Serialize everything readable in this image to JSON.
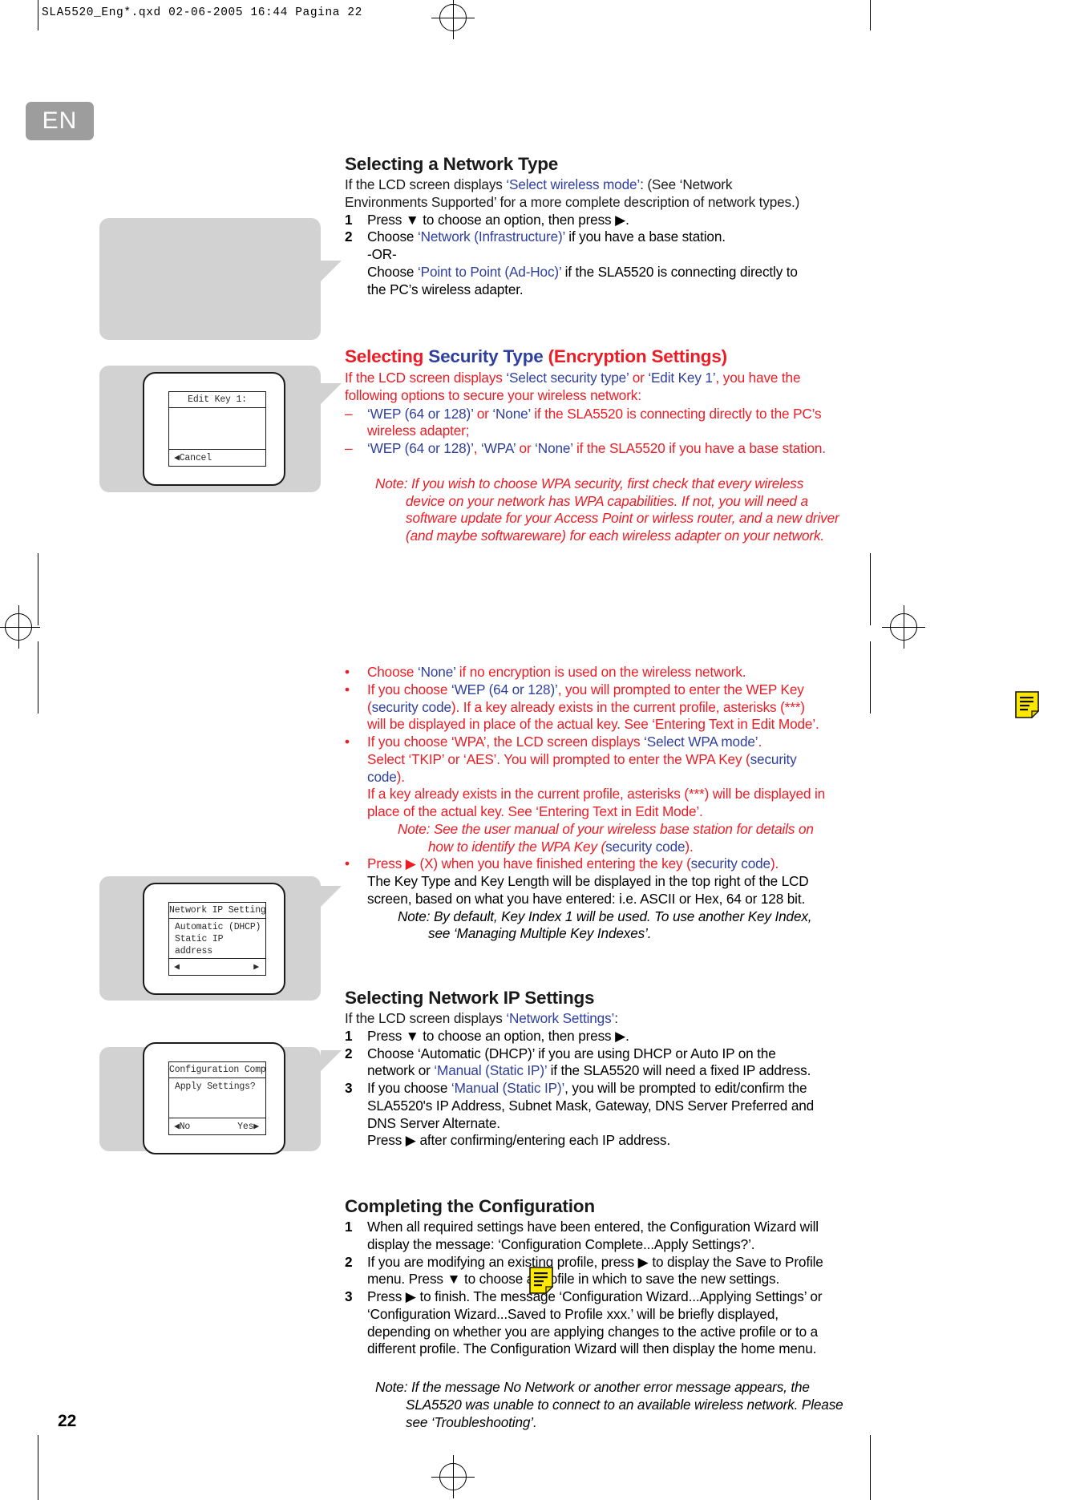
{
  "printer_slug": "SLA5520_Eng*.qxd  02-06-2005  16:44  Pagina 22",
  "language_tab": "EN",
  "page_number": "22",
  "colors": {
    "blue": "#2e3f9e",
    "red": "#ec1c24",
    "grey_panel": "#d2d2d2",
    "lang_tab_bg": "#9d9d9d"
  },
  "sections": {
    "network_type": {
      "heading": "Selecting a Network Type",
      "intro_a": "If the LCD screen displays ",
      "intro_blue": "‘Select wireless mode’",
      "intro_b": ": (See ‘Network Environments Supported’ for a more complete description of network types.)",
      "steps": [
        {
          "num": "1",
          "a": "Press ▼ to choose an option, then press ▶."
        },
        {
          "num": "2",
          "a": "Choose ",
          "blue1": "‘Network (Infrastructure)’",
          "b": " if you have a base station.",
          "or": "-OR-",
          "c": "Choose ",
          "blue2": "‘Point to Point (Ad-Hoc)’",
          "d": " if the SLA5520 is connecting directly to the PC’s wireless adapter."
        }
      ]
    },
    "security_type": {
      "heading_red1": "Selecting ",
      "heading_blue": "Security Type ",
      "heading_red2": "(Encryption Settings)",
      "intro_a": "If the LCD screen displays ",
      "intro_blue1": "‘Select security type’",
      "intro_b": " or ",
      "intro_blue2": "‘Edit Key 1’",
      "intro_c": ", you have the following options to secure your wireless network:",
      "dashes": [
        {
          "blue1": "‘WEP (64 or 128)’",
          "mid": " or ",
          "blue2": "‘None’",
          "tail": " if the SLA5520 is connecting directly to the PC’s wireless adapter;"
        },
        {
          "blue1": "‘WEP (64 or 128)’",
          "mid": ", ",
          "blue2": "‘WPA’",
          "mid2": " or ",
          "blue3": "‘None’",
          "tail": " if the SLA5520 if you have a base station."
        }
      ],
      "note_wpa": "Note: If you wish to choose WPA security, first check that every wireless device on your network has WPA capabilities. If not, you will need a software update for your Access Point or wirless router, and a new driver (and maybe softwareware) for each wireless adapter on your network.",
      "bullets": [
        {
          "a": "Choose ",
          "blue1": "‘None’",
          "b": " if no encryption is used on the wireless network."
        },
        {
          "a": "If you choose ",
          "blue1": "‘WEP (64 or 128)’",
          "b": ", you will prompted to enter the WEP Key (",
          "blue2": "security code",
          "c": "). If a key already exists in the current profile, asterisks (***) will be displayed in place of the actual key. See ‘Entering Text in Edit Mode’."
        },
        {
          "a": "If you choose ‘WPA’, the LCD screen displays ",
          "blue1": "‘Select WPA mode’",
          "b": ".",
          "l2_a": "Select ‘TKIP’ or ‘AES’. You will prompted to enter the WPA Key (",
          "l2_blue": "security code",
          "l2_b": ").",
          "l3": "If a key already exists in the current profile, asterisks (***) will be displayed in place of the actual key. See ‘Entering Text in Edit Mode’.",
          "note_a": "Note: See the user manual of your wireless base station for details on how to identify the WPA Key (",
          "note_blue": "security code",
          "note_b": ")."
        },
        {
          "a": "Press ▶ (X) when you have finished entering the key (",
          "blue1": "security code",
          "b": ").",
          "black1": "The Key Type and Key Length will be displayed in the top right of the LCD screen, based on what you have entered: i.e. ASCII or Hex, 64 or 128 bit.",
          "note": "Note: By default, Key Index 1 will be used. To use another Key Index, see ‘Managing Multiple Key Indexes’."
        }
      ]
    },
    "network_ip": {
      "heading": "Selecting Network IP Settings",
      "intro_a": "If the LCD screen displays ",
      "intro_blue": "‘Network Settings’",
      "intro_b": ":",
      "steps": [
        {
          "num": "1",
          "a": "Press ▼ to choose an option, then press ▶."
        },
        {
          "num": "2",
          "a": "Choose ‘Automatic (DHCP)’ if you are using DHCP or Auto IP on the network or ",
          "blue1": "‘Manual (Static IP)’",
          "b": " if the SLA5520 will need a fixed IP address."
        },
        {
          "num": "3",
          "a": "If you choose ",
          "blue1": "‘Manual (Static IP)’",
          "b": ", you will be prompted to edit/confirm the SLA5520's IP Address, Subnet Mask, Gateway, DNS Server Preferred and DNS Server Alternate.",
          "c": "Press ▶ after confirming/entering each IP address."
        }
      ]
    },
    "completing": {
      "heading": "Completing the Configuration",
      "steps": [
        {
          "num": "1",
          "a": "When all required settings have been entered, the Configuration Wizard will display the message: ‘Configuration Complete...Apply Settings?’."
        },
        {
          "num": "2",
          "a": "If you are modifying an existing profile, press ▶ to display the Save to Profile menu. Press ▼ to choose a profile in which to save the new settings."
        },
        {
          "num": "3",
          "a": "Press ▶ to finish. The message ‘Configuration Wizard...Applying Settings’ or ‘Configuration Wizard...Saved to Profile xxx.’ will be briefly displayed, depending on whether you are applying changes to the active profile or to a different profile. The Configuration Wizard will then display the home menu."
        }
      ],
      "note": "Note: If the message No Network or another error message appears, the SLA5520 was unable to connect to an available wireless network. Please see ‘Troubleshooting’."
    }
  },
  "lcd_screens": {
    "edit_key": {
      "title": "Edit Key 1:",
      "body": "",
      "foot_left": "◀Cancel",
      "foot_right": ""
    },
    "network_ip_settings": {
      "title": "Network IP Settings:",
      "line1": "Automatic (DHCP)",
      "line2": "Static IP address",
      "foot_left": "◀",
      "foot_right": "▶"
    },
    "config_complete": {
      "title": "Configuration Complete:",
      "line1": "Apply Settings?",
      "foot_left": "◀No",
      "foot_right": "Yes▶"
    }
  }
}
